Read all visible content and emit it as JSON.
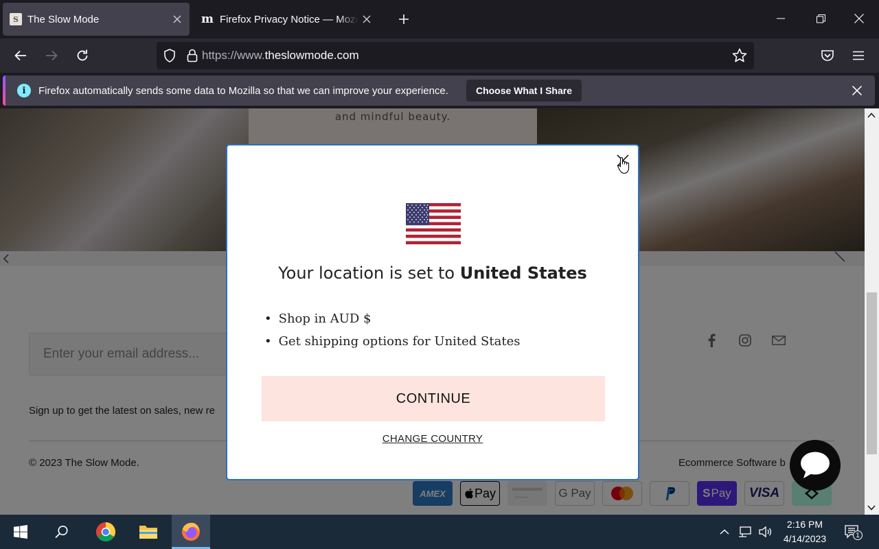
{
  "browser": {
    "tabs": [
      {
        "title": "The Slow Mode",
        "favicon": "S",
        "active": true
      },
      {
        "title": "Firefox Privacy Notice — Mozilla",
        "favicon": "m",
        "active": false
      }
    ],
    "url_prefix": "https://www.",
    "url_domain": "theslowmode.com",
    "notification": {
      "message": "Firefox automatically sends some data to Mozilla so that we can improve your experience.",
      "button": "Choose What I Share"
    }
  },
  "page": {
    "hero_caption": "and mindful beauty.",
    "email_placeholder": "Enter your email address...",
    "signup_text": "Sign up to get the latest on sales, new re",
    "copyright": "© 2023 The Slow Mode.",
    "ecommerce": "Ecommerce Software b",
    "payments": [
      "AMEX",
      "Apple Pay",
      "Card",
      "G Pay",
      "Mastercard",
      "PayPal",
      "Shop Pay",
      "VISA",
      "Afterpay"
    ]
  },
  "modal": {
    "title_prefix": "Your location is set to ",
    "title_country": "United States",
    "bullets": [
      "Shop in AUD $",
      "Get shipping options for United States"
    ],
    "continue": "CONTINUE",
    "change_country": "CHANGE COUNTRY"
  },
  "taskbar": {
    "time": "2:16 PM",
    "date": "4/14/2023",
    "notification_count": "1"
  },
  "colors": {
    "modal_border": "#2b6fbf",
    "continue_bg": "#fde4df",
    "browser_dark": "#1c1b22"
  }
}
